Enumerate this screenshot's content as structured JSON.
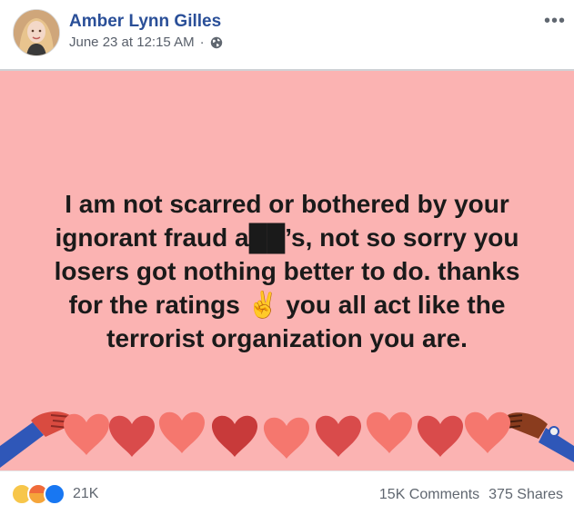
{
  "post": {
    "author": "Amber Lynn Gilles",
    "timestamp": "June 23 at 12:15 AM",
    "separator": "·",
    "privacy_icon": "globe-icon",
    "more_icon": "more-options-icon",
    "text": "I am not scarred or bothered by your\nignorant fraud a██’s, not so sorry you\nlosers got nothing better to do. thanks\nfor the ratings ✌️ you all act like the\nterrorist organization you are.",
    "background_color": "#fbb3b2"
  },
  "footer": {
    "reaction_icons": [
      "haha-icon",
      "angry-icon",
      "like-icon"
    ],
    "reaction_count": "21K",
    "comments": "15K Comments",
    "shares": "375 Shares"
  }
}
